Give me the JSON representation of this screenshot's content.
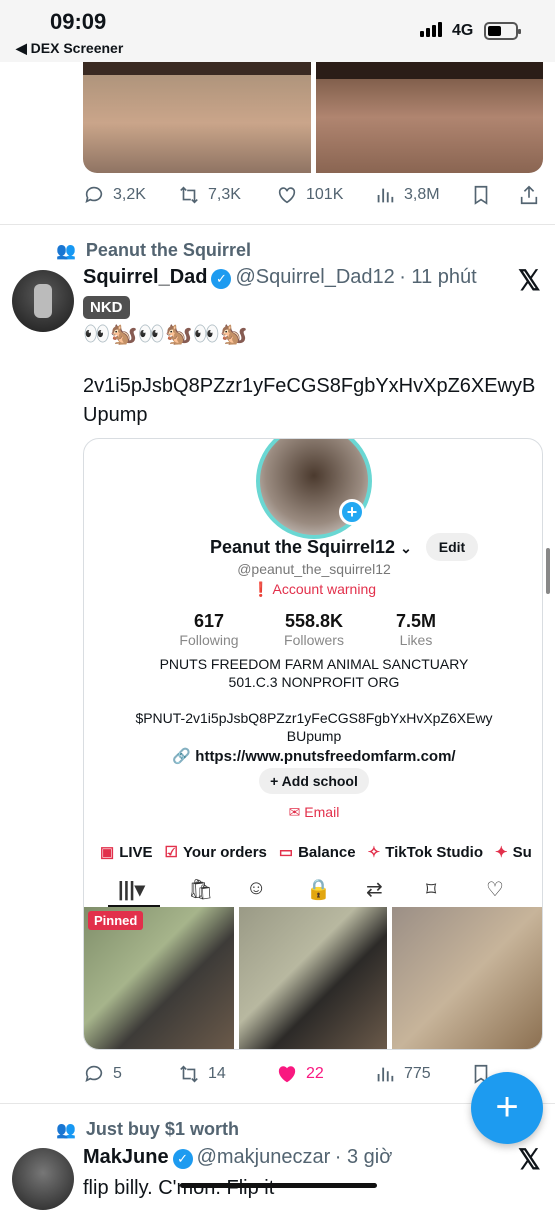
{
  "status": {
    "time": "09:09",
    "back_app": "◀ DEX Screener",
    "network": "4G"
  },
  "tweet1": {
    "actions": {
      "replies": "3,2K",
      "retweets": "7,3K",
      "likes": "101K",
      "views": "3,8M"
    }
  },
  "tweet2": {
    "context": "Peanut the Squirrel",
    "name": "Squirrel_Dad",
    "handle": "@Squirrel_Dad12",
    "time": "· 11 phút",
    "tag": "NKD",
    "emoji_line": "👀🐿️👀🐿️👀🐿️",
    "text": "2v1i5pJsbQ8PZzr1yFeCGS8FgbYxHvXpZ6XEwyB",
    "text2": "Upump",
    "card": {
      "profile_name": "Peanut the Squirrel12",
      "edit": "Edit",
      "username": "@peanut_the_squirrel12",
      "warning": "Account warning",
      "stats": [
        {
          "num": "617",
          "label": "Following"
        },
        {
          "num": "558.8K",
          "label": "Followers"
        },
        {
          "num": "7.5M",
          "label": "Likes"
        }
      ],
      "bio1": "PNUTS FREEDOM FARM ANIMAL SANCTUARY",
      "bio2": "501.C.3 NONPROFIT ORG",
      "bio3": "$PNUT-2v1i5pJsbQ8PZzr1yFeCGS8FgbYxHvXpZ6XEwy",
      "bio4": "BUpump",
      "link": "https://www.pnutsfreedomfarm.com/",
      "add_school": "+ Add school",
      "email": "Email",
      "toolbar": [
        "LIVE",
        "Your orders",
        "Balance",
        "TikTok Studio",
        "Su"
      ],
      "pinned": "Pinned"
    },
    "actions": {
      "replies": "5",
      "retweets": "14",
      "likes": "22",
      "views": "775"
    }
  },
  "tweet3": {
    "context": "Just buy $1 worth",
    "name": "MakJune",
    "handle": "@makjuneczar",
    "time": "· 3 giờ",
    "text": "flip billy. C'mon. Flip it"
  },
  "colors": {
    "accent": "#1d9bf0",
    "like": "#f91880",
    "warning": "#e2304b"
  }
}
